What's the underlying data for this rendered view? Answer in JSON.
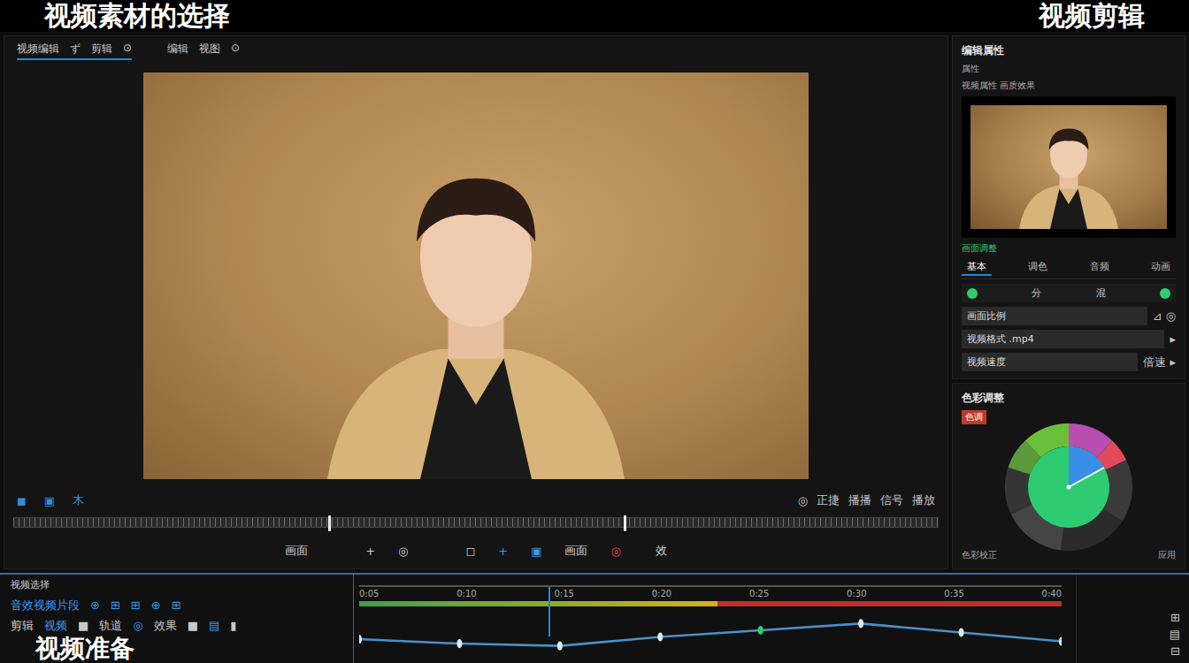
{
  "header": {
    "left_title": "视频素材的选择",
    "right_title": "视频剪辑"
  },
  "footer_title": "视频准备",
  "toolbar": {
    "groups": [
      [
        "视频编辑",
        "ず",
        "剪辑",
        "⊙"
      ],
      [
        "编辑",
        "视图",
        "⊙"
      ]
    ]
  },
  "transport": {
    "left": [
      {
        "label": "◼",
        "color": "#2d8fd8"
      },
      {
        "label": "▣",
        "color": "#2d8fd8"
      },
      {
        "label": "木",
        "color": "#2d8fd8"
      }
    ],
    "right": [
      "◎",
      "正捷",
      "播播",
      "信号",
      "播放"
    ]
  },
  "scrubber": {
    "markers": [
      0.34,
      0.66
    ]
  },
  "tools": [
    {
      "label": "画面",
      "color": "#d0d0d0"
    },
    {
      "label": "ゞ",
      "color": "#d0d0d0"
    },
    {
      "label": "+",
      "color": "#d0d0d0"
    },
    {
      "label": "◎",
      "color": "#d0d0d0"
    },
    {
      "label": "ゞ",
      "color": "#d0d0d0"
    },
    {
      "label": "◻",
      "color": "#d0d0d0"
    },
    {
      "label": "+",
      "color": "#3a9be8"
    },
    {
      "label": "▣",
      "color": "#3a9be8"
    },
    {
      "label": "画面",
      "color": "#d0d0d0"
    },
    {
      "label": "◎",
      "color": "#e04040"
    },
    {
      "label": "ゞ效",
      "color": "#d0d0d0"
    }
  ],
  "inspector": {
    "title": "编辑属性",
    "subtitle": "属性",
    "meta": "视频属性 画质效果",
    "section": "画面调整",
    "tabs": [
      {
        "label": "基本",
        "selected": true
      },
      {
        "label": "调色",
        "selected": false
      },
      {
        "label": "音频",
        "selected": false
      },
      {
        "label": "动画",
        "selected": false
      }
    ],
    "toggle_row": {
      "on": true,
      "labels": [
        "分",
        "混"
      ]
    },
    "fields": [
      {
        "label": "画面比例",
        "value": "⊿ ◎"
      },
      {
        "label": "视频格式 .mp4",
        "value": "▸"
      },
      {
        "label": "视频速度",
        "value": "倍速 ▸"
      }
    ]
  },
  "color_panel": {
    "title": "色彩调整",
    "tag": "色调",
    "segments": [
      {
        "color": "#b84fb0",
        "value": 12
      },
      {
        "color": "#e04a5a",
        "value": 6
      },
      {
        "color": "#3a3a3a",
        "value": 16
      },
      {
        "color": "#2b2b2b",
        "value": 18
      },
      {
        "color": "#454545",
        "value": 16
      },
      {
        "color": "#353535",
        "value": 12
      },
      {
        "color": "#5a9a3a",
        "value": 8
      },
      {
        "color": "#6abf3a",
        "value": 12
      }
    ],
    "center_color": "#2ecc71",
    "accent_color": "#3a8ee6",
    "footer_left": "色彩校正",
    "footer_right": "应用"
  },
  "timeline": {
    "title": "视频选择",
    "subtitle": "音效视频片段",
    "header_icons": [
      "⊕",
      "⊞",
      "⊞",
      "⊕",
      "⊞"
    ],
    "track_labels": [
      "剪辑",
      "视频",
      "■",
      "轨道",
      "◎",
      "效果",
      "■",
      "▤",
      "▮"
    ],
    "ruler": [
      "0:05",
      "0:10",
      "0:15",
      "0:20",
      "0:25",
      "0:30",
      "0:35",
      "0:40"
    ],
    "progress": {
      "level": 0.51
    },
    "playhead": 0.27,
    "curve": [
      40,
      30,
      25,
      45,
      60,
      75,
      55,
      35
    ]
  },
  "side_icons": [
    "⊞",
    "▤",
    "⊟"
  ]
}
